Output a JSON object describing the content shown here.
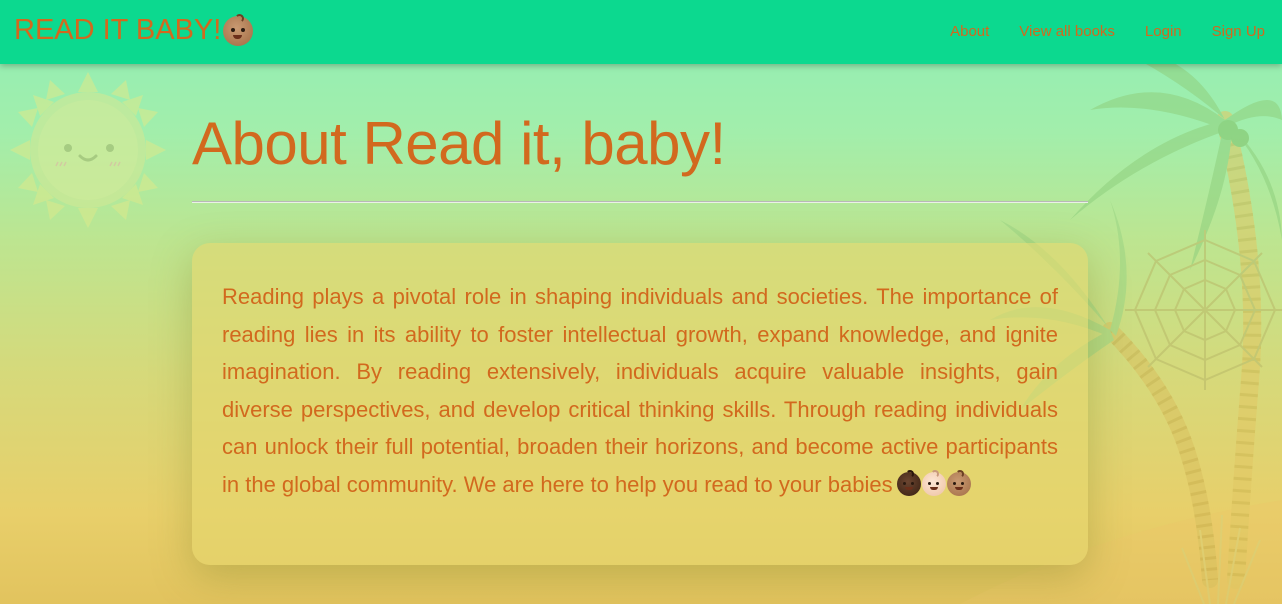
{
  "navbar": {
    "brand": "READ IT BABY!",
    "brand_emoji": "baby-face-medium-skin-icon",
    "links": [
      {
        "label": "About"
      },
      {
        "label": "View all books"
      },
      {
        "label": "Login"
      },
      {
        "label": "Sign Up"
      }
    ]
  },
  "main": {
    "title": "About Read it, baby!",
    "paragraph": "Reading plays a pivotal role in shaping individuals and societies. The importance of reading lies in its ability to foster intellectual growth, expand knowledge, and ignite imagination. By reading extensively, individuals acquire valuable insights, gain diverse perspectives, and develop critical thinking skills. Through reading individuals can unlock their full potential, broaden their horizons, and become active participants in the global community. We are here to help you read to your babies",
    "trailing_emojis": [
      {
        "icon": "baby-dark-skin-icon",
        "color": "#5a3a26"
      },
      {
        "icon": "baby-light-skin-icon",
        "color": "#f6d7c0"
      },
      {
        "icon": "baby-medium-skin-icon",
        "color": "#b9865f"
      }
    ]
  },
  "colors": {
    "navbar": "#0cd98f",
    "accent_text": "#d2691e",
    "background_top": "#8eeeb7",
    "background_bottom": "#e2c35e"
  },
  "decorations": {
    "sun": "smiling-sun-icon",
    "palm": "palm-tree-icon",
    "web": "spider-web-icon"
  }
}
